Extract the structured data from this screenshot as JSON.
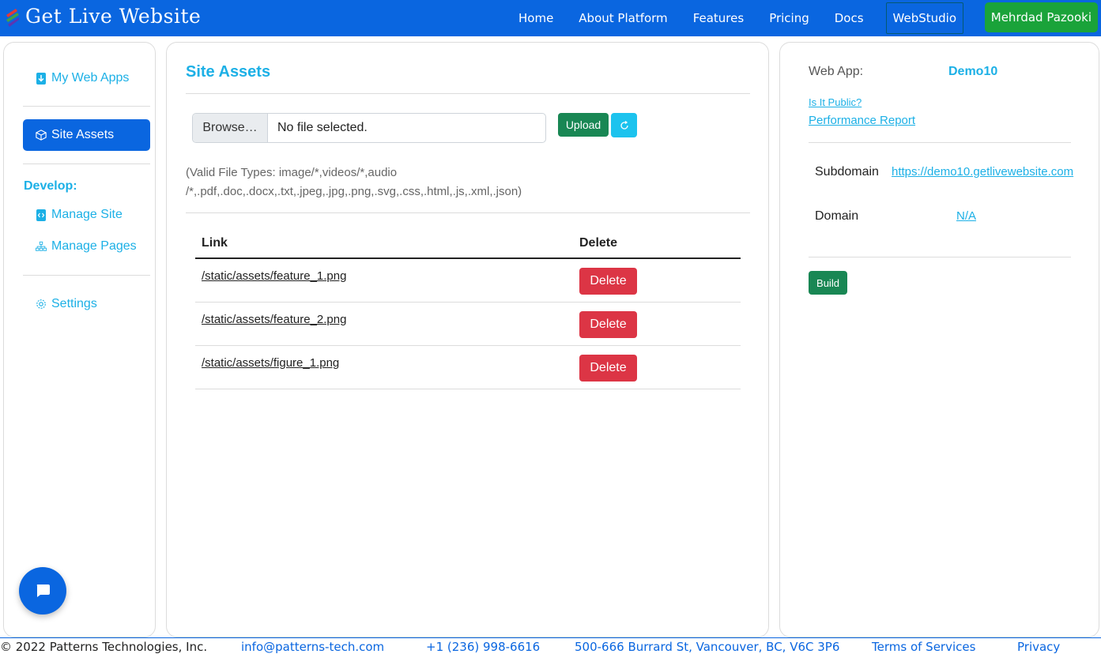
{
  "brand": {
    "name": "Get Live Website",
    "logo_icon": "brand-stripes-icon"
  },
  "nav": {
    "items": [
      "Home",
      "About Platform",
      "Features",
      "Pricing",
      "Docs",
      "WebStudio"
    ],
    "user": "Mehrdad Pazooki"
  },
  "sidebar": {
    "my_web_apps": "My Web Apps",
    "site_assets": "Site Assets",
    "develop_heading": "Develop:",
    "manage_site": "Manage Site",
    "manage_pages": "Manage Pages",
    "settings": "Settings"
  },
  "main": {
    "title": "Site Assets",
    "file_input": {
      "browse_label": "Browse…",
      "status": "No file selected."
    },
    "upload_label": "Upload",
    "valid_types_line1": "(Valid File Types: image/*,videos/*,audio",
    "valid_types_line2": "/*,.pdf,.doc,.docx,.txt,.jpeg,.jpg,.png,.svg,.css,.html,.js,.xml,.json)",
    "table": {
      "headers": [
        "Link",
        "Delete"
      ],
      "rows": [
        {
          "link": "/static/assets/feature_1.png",
          "action": "Delete"
        },
        {
          "link": "/static/assets/feature_2.png",
          "action": "Delete"
        },
        {
          "link": "/static/assets/figure_1.png",
          "action": "Delete"
        }
      ]
    }
  },
  "details": {
    "web_app_label": "Web App:",
    "web_app_value": "Demo10",
    "is_public_link": "Is It Public?",
    "performance_link": "Performance Report",
    "subdomain_label": "Subdomain",
    "subdomain_value": "https://demo10.getlivewebsite.com",
    "domain_label": "Domain",
    "domain_value": "N/A",
    "build_label": "Build"
  },
  "footer": {
    "copyright": "© 2022 Patterns Technologies, Inc.",
    "email": "info@patterns-tech.com",
    "phone": "+1 (236) 998-6616",
    "address": "500-666 Burrard St, Vancouver, BC, V6C 3P6",
    "terms": "Terms of Services",
    "privacy": "Privacy"
  },
  "colors": {
    "primary": "#0a66e0",
    "accent": "#1cb0e6",
    "success": "#198754",
    "danger": "#dc3545"
  }
}
